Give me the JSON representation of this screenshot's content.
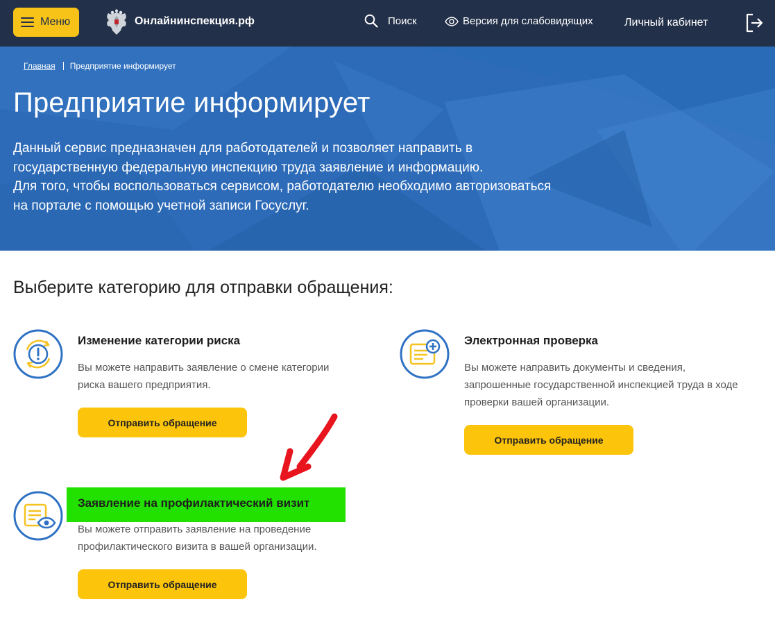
{
  "header": {
    "menu_label": "Меню",
    "site_name": "Онлайнинспекция.рф",
    "search_label": "Поиск",
    "vision_label": "Версия для слабовидящих",
    "cabinet_label": "Личный кабинет"
  },
  "hero": {
    "breadcrumb": {
      "home": "Главная",
      "current": "Предприятие информирует"
    },
    "title": "Предприятие информирует",
    "description_lines": [
      "Данный сервис предназначен для работодателей и позволяет направить в",
      "государственную федеральную инспекцию труда заявление и информацию.",
      "Для того, чтобы воспользоваться сервисом, работодателю необходимо авторизоваться",
      "на портале с помощью учетной записи Госуслуг."
    ]
  },
  "content": {
    "section_title": "Выберите категорию для отправки обращения:",
    "cards": [
      {
        "icon": "risk-category-icon",
        "title": "Изменение категории риска",
        "description_lines": [
          "Вы можете направить заявление о смене категории",
          "риска вашего предприятия."
        ],
        "button_label": "Отправить обращение"
      },
      {
        "icon": "electronic-inspection-icon",
        "title": "Электронная проверка",
        "description_lines": [
          "Вы можете направить документы и сведения,",
          "запрошенные государственной инспекцией труда в ходе",
          "проверки вашей организации."
        ],
        "button_label": "Отправить обращение"
      },
      {
        "icon": "preventive-visit-icon",
        "title": "Заявление на профилактический визит",
        "description_lines": [
          "Вы можете отправить заявление на проведение",
          "профилактического визита в вашей организации."
        ],
        "button_label": "Отправить обращение"
      }
    ]
  },
  "colors": {
    "header_bg": "#23304a",
    "accent_yellow": "#fcc40a",
    "hero_blue": "#2d6bb8",
    "icon_blue": "#2f72c4",
    "highlight_green": "#22e000",
    "arrow_red": "#e8141e"
  }
}
